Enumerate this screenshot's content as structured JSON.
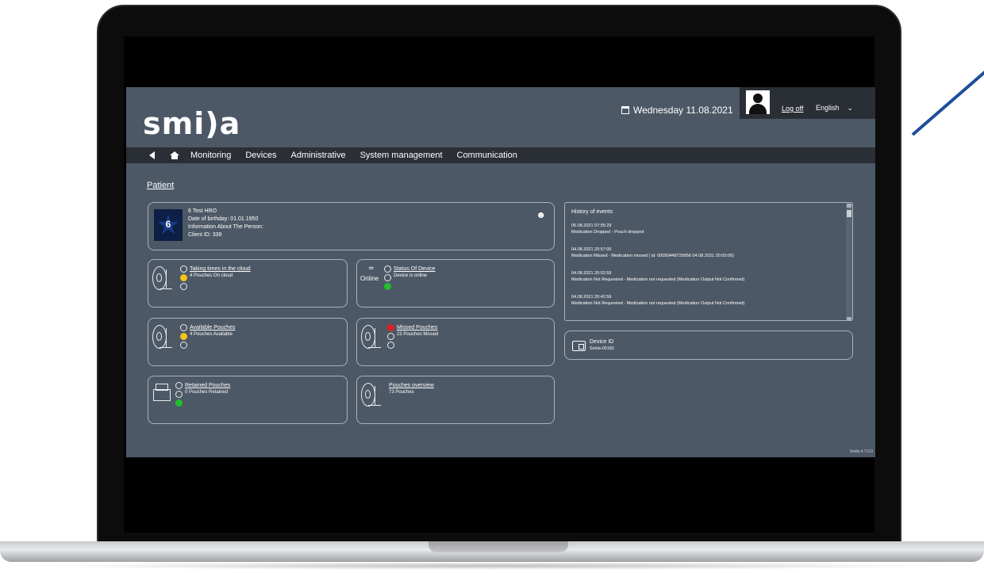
{
  "app": {
    "logo": "smi)a",
    "version": "Smila 4.7.0.0"
  },
  "header": {
    "date": "Wednesday 11.08.2021",
    "logoff_label": "Log off",
    "language": "English",
    "language_chevron": "⌄"
  },
  "nav": {
    "items": [
      "Monitoring",
      "Devices",
      "Administrative",
      "System management",
      "Communication"
    ]
  },
  "page": {
    "title": "Patient"
  },
  "patient": {
    "avatar_number": "6",
    "name": "6 Test HRO",
    "birthday": "Date of birthday: 01.01.1950",
    "info": "Information About The Person:",
    "client_id": "Client ID: 339"
  },
  "tiles": {
    "cloud": {
      "title": "Taking times in the cloud",
      "subtitle": "4 Pouches On cloud"
    },
    "status": {
      "title": "Status Of Device",
      "subtitle": "Device is online",
      "state": "Online"
    },
    "available": {
      "title": "Available Pouches",
      "subtitle": "4 Pouches Available"
    },
    "missed": {
      "title": "Missed Pouches",
      "subtitle": "23 Pouches Missed"
    },
    "retained": {
      "title": "Retained Pouches",
      "subtitle": "0 Pouches Retained"
    },
    "overview": {
      "title": "Pouches overview",
      "subtitle": "73 Pouches"
    }
  },
  "history": {
    "title": "History of events",
    "events": [
      {
        "time": "05.08.2021 07:55:29",
        "text": "Medication Dropped - Pouch dropped"
      },
      {
        "time": "04.08.2021 20:57:00",
        "text": "Medication Missed - Medication missed ( id: 00050448729056 04.08.2021 20:00:00)"
      },
      {
        "time": "04.08.2021 20:52:59",
        "text": "Medication Not Requested - Medication not requested (Medication Output Not Confirmed)"
      },
      {
        "time": "04.08.2021 20:42:59",
        "text": "Medication Not Requested - Medication not requested (Medication Output Not Confirmed)"
      }
    ]
  },
  "device": {
    "title": "Device ID",
    "value": "Smila-00182"
  },
  "colors": {
    "background": "#4d5866",
    "bar": "#2a2f35",
    "yellow": "#f2c31b",
    "red": "#e02020",
    "green": "#22c02b"
  }
}
